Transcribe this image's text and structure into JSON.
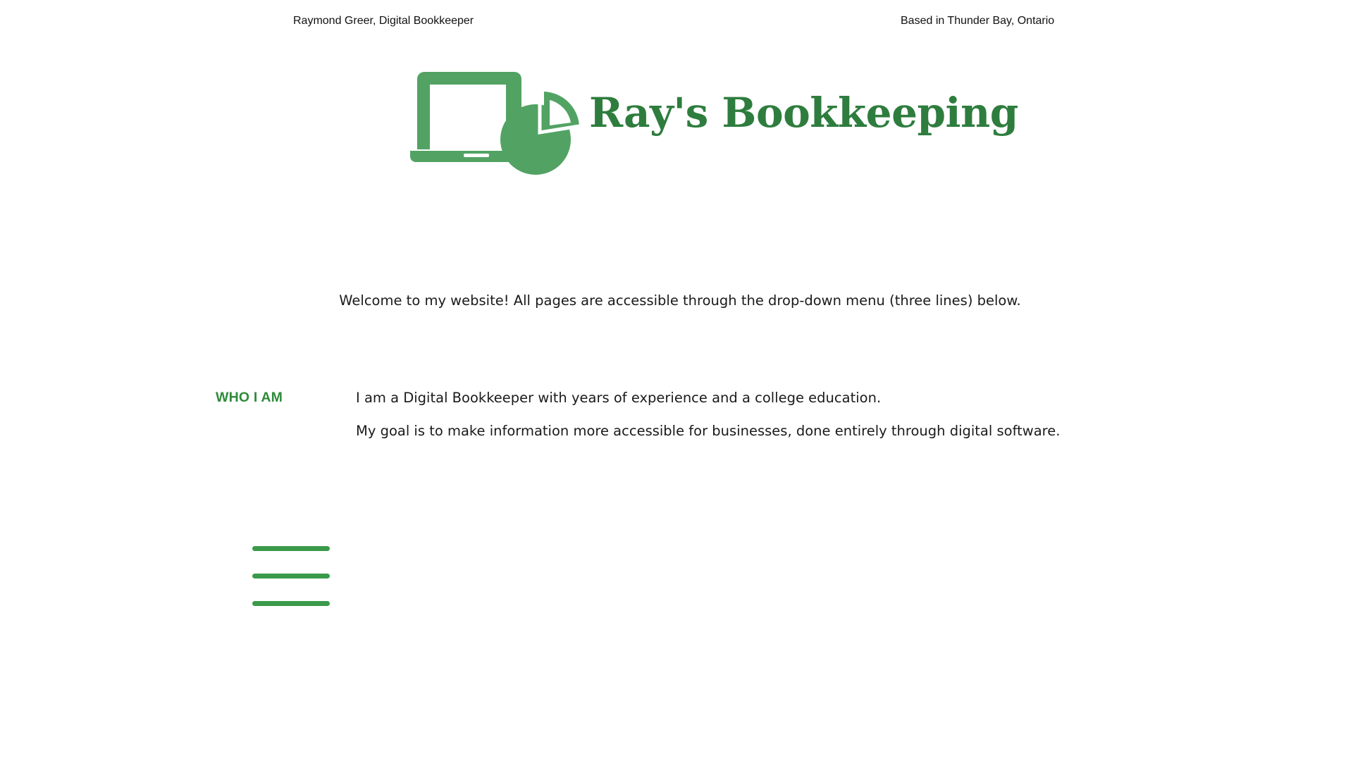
{
  "header": {
    "left_text": "Raymond Greer, Digital Bookkeeper",
    "right_text": "Based in Thunder Bay, Ontario"
  },
  "logo": {
    "text": "Ray's Bookkeeping",
    "icon": "laptop-pie-chart-icon",
    "color": "#2e7d3e",
    "icon_color": "#52a363"
  },
  "welcome": {
    "text": "Welcome to my website!  All pages are accessible through the drop-down menu (three lines) below."
  },
  "who_i_am": {
    "heading": "WHO I AM",
    "heading_color": "#2e8b3a",
    "lines": [
      "I am a Digital Bookkeeper with years of experience and a college education.",
      "My goal is to make information more accessible for businesses, done entirely through digital software."
    ]
  },
  "menu": {
    "icon": "hamburger-menu-icon",
    "color": "#3a9a4a"
  }
}
